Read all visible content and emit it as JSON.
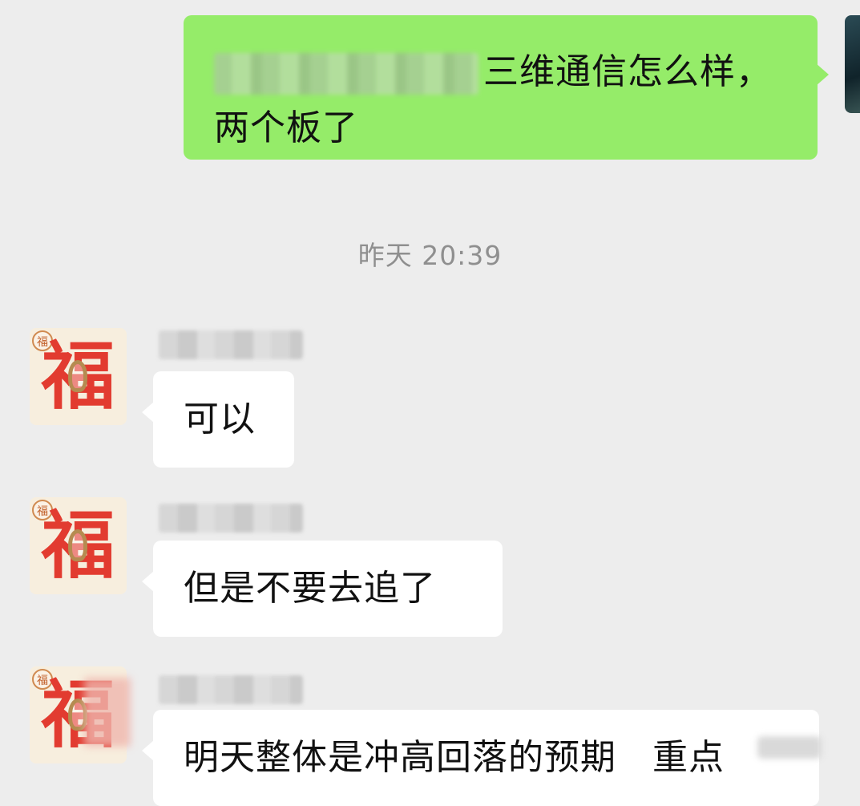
{
  "conversation": {
    "outgoing": {
      "text": "三维通信怎么样，\n两个板了"
    },
    "timestamp": "昨天 20:39",
    "incoming": [
      {
        "avatar_text": "福",
        "avatar_badge": "福",
        "text": "可以"
      },
      {
        "avatar_text": "福",
        "avatar_badge": "福",
        "text": "但是不要去追了"
      },
      {
        "avatar_text": "福",
        "avatar_badge": "福",
        "text": "明天整体是冲高回落的预期   重点"
      }
    ]
  },
  "colors": {
    "background": "#ededed",
    "outgoing_bubble": "#95ec69",
    "incoming_bubble": "#ffffff",
    "timestamp": "#8f8f8f",
    "avatar_char": "#e23b30"
  },
  "icons": {
    "self_avatar": "user-photo-avatar",
    "contact_avatar": "fu-snake-avatar"
  }
}
